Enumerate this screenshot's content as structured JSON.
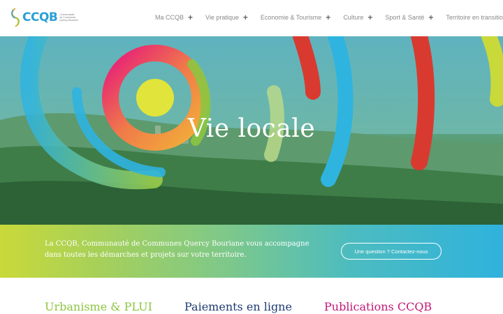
{
  "logo": {
    "text": "CCQB",
    "subtitle_lines": [
      "Communauté",
      "de Communes",
      "Quercy Bouriane"
    ]
  },
  "nav": {
    "items": [
      {
        "label": "Ma CCQB",
        "icon": "plus-icon"
      },
      {
        "label": "Vie pratique",
        "icon": "plus-icon"
      },
      {
        "label": "Economie & Tourisme",
        "icon": "plus-icon"
      },
      {
        "label": "Culture",
        "icon": "plus-icon"
      },
      {
        "label": "Sport & Santé",
        "icon": "plus-icon"
      },
      {
        "label": "Territoire en transition",
        "icon": "plus-icon"
      }
    ]
  },
  "hero": {
    "title": "Vie locale"
  },
  "band": {
    "text": "La CCQB, Communauté de Communes Quercy Bouriane vous accompagne dans toutes les démarches et projets sur votre territoire.",
    "button_label": "Une question ? Contactez-nous"
  },
  "sections": [
    {
      "title": "Urbanisme & PLUI",
      "color": "#8cc540"
    },
    {
      "title": "Paiements en ligne",
      "color": "#1f3b70"
    },
    {
      "title": "Publications CCQB",
      "color": "#c2187a"
    }
  ],
  "colors": {
    "brand_blue": "#2a9fd6",
    "nav_text": "#8a8a8a"
  }
}
